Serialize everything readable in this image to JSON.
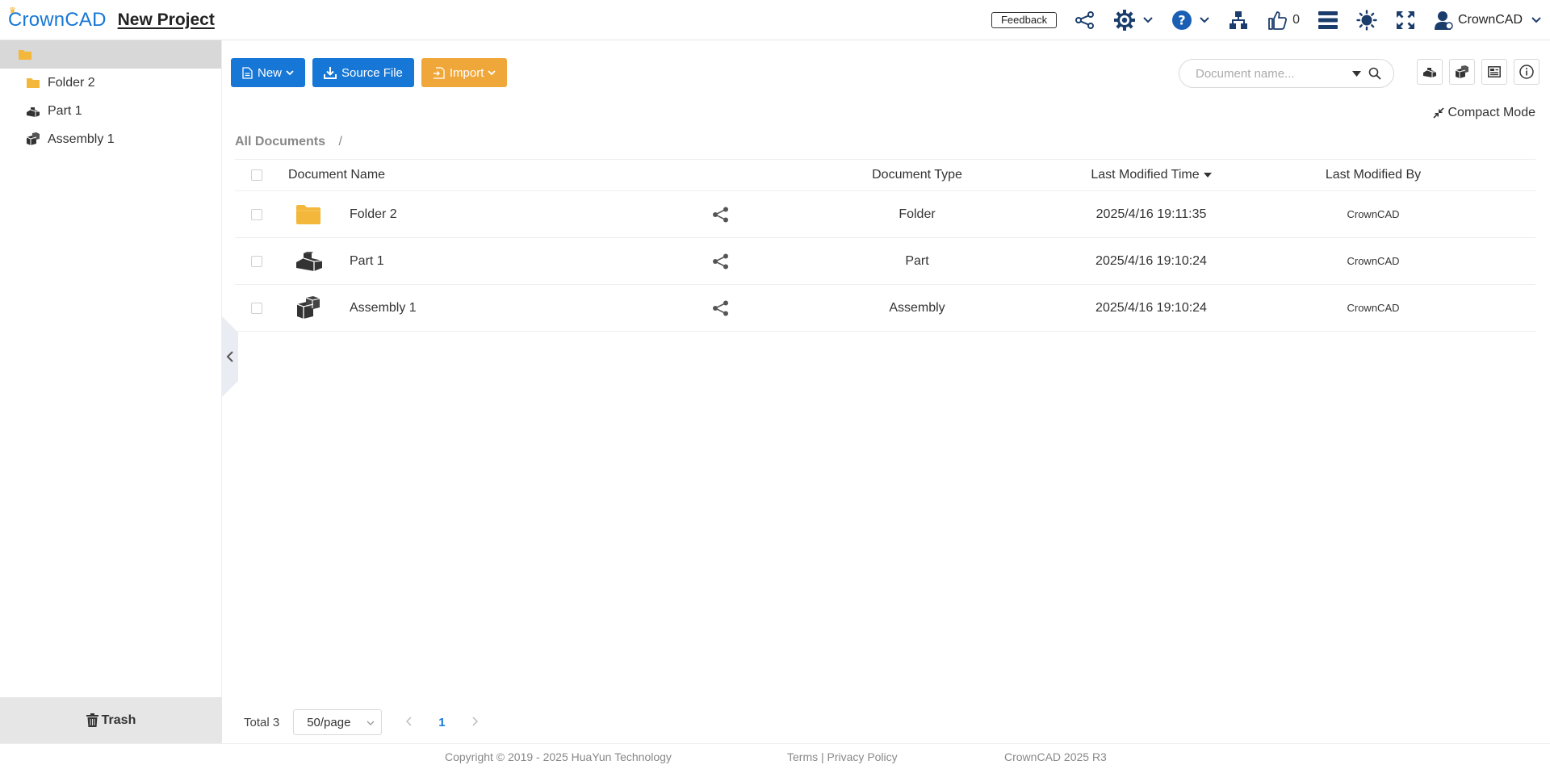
{
  "header": {
    "logo_text": "CrownCAD",
    "project_title": "New Project",
    "feedback_label": "Feedback",
    "like_count": "0",
    "user_name": "CrownCAD",
    "icons": [
      "share-icon",
      "settings-icon",
      "help-icon",
      "hierarchy-icon",
      "thumbs-up-icon",
      "list-icon",
      "theme-icon",
      "fullscreen-icon",
      "user-icon"
    ]
  },
  "sidebar": {
    "root_label": "",
    "items": [
      {
        "label": "Folder 2",
        "icon": "folder-icon"
      },
      {
        "label": "Part 1",
        "icon": "part-icon"
      },
      {
        "label": "Assembly 1",
        "icon": "assembly-icon"
      }
    ],
    "trash_label": "Trash"
  },
  "toolbar": {
    "new_label": "New",
    "source_file_label": "Source File",
    "import_label": "Import"
  },
  "search": {
    "placeholder": "Document name..."
  },
  "compact_mode_label": "Compact Mode",
  "breadcrumb": {
    "root": "All Documents",
    "separator": "/"
  },
  "table": {
    "columns": {
      "name": "Document Name",
      "type": "Document Type",
      "time": "Last Modified Time",
      "by": "Last Modified By"
    },
    "rows": [
      {
        "name": "Folder 2",
        "type": "Folder",
        "time": "2025/4/16 19:11:35",
        "by": "CrownCAD",
        "icon": "folder-icon"
      },
      {
        "name": "Part 1",
        "type": "Part",
        "time": "2025/4/16 19:10:24",
        "by": "CrownCAD",
        "icon": "part-icon"
      },
      {
        "name": "Assembly 1",
        "type": "Assembly",
        "time": "2025/4/16 19:10:24",
        "by": "CrownCAD",
        "icon": "assembly-icon"
      }
    ]
  },
  "pagination": {
    "total_label": "Total 3",
    "page_size": "50/page",
    "current_page": "1"
  },
  "footer": {
    "copyright": "Copyright © 2019 - 2025 HuaYun Technology",
    "links": "Terms | Privacy Policy",
    "version": "CrownCAD 2025 R3"
  },
  "colors": {
    "primary": "#1677d6",
    "import_orange": "#f0a73a",
    "folder_yellow": "#f3b73b",
    "sidebar_selected": "#d8d8d8"
  }
}
